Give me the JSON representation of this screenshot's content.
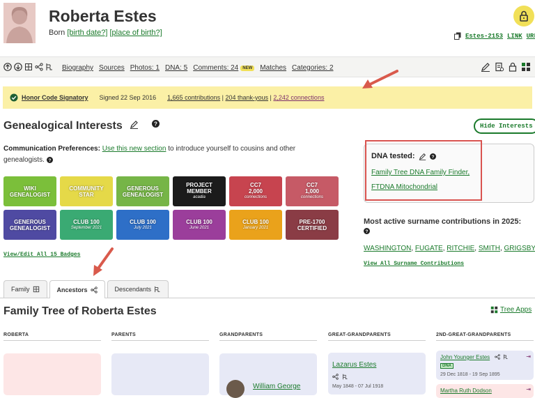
{
  "profile": {
    "name": "Roberta Estes",
    "born_prefix": "Born",
    "birth_date": "[birth date?]",
    "birth_place": "[place of birth?]",
    "id": "Estes-2153",
    "link_label": "LINK",
    "url_label": "URL"
  },
  "nav": {
    "biography": "Biography",
    "sources": "Sources",
    "photos": "Photos: 1",
    "dna": "DNA: 5",
    "comments": "Comments: 24",
    "new_badge": "NEW",
    "matches": "Matches",
    "categories": "Categories: 2"
  },
  "honor": {
    "label": "Honor Code Signatory",
    "signed": "Signed 22 Sep 2016",
    "contributions": "1,665 contributions",
    "sep1": " | ",
    "thankyous": "204 thank-yous",
    "sep2": " | ",
    "connections": "2,242 connections"
  },
  "interests": {
    "title": "Genealogical Interests",
    "hide_button": "Hide Interests",
    "comm_label": "Communication Preferences:",
    "comm_link": "Use this new section",
    "comm_text": " to introduce yourself to cousins and other genealogists."
  },
  "badges": [
    {
      "line1": "WIKI",
      "line2": "GENEALOGIST",
      "sub": "",
      "color": "#7bbf3a"
    },
    {
      "line1": "COMMUNITY",
      "line2": "STAR",
      "sub": "",
      "color": "#e5d948"
    },
    {
      "line1": "GENEROUS",
      "line2": "GENEALOGIST",
      "sub": "",
      "color": "#76b547"
    },
    {
      "line1": "PROJECT",
      "line2": "MEMBER",
      "sub": "acadia",
      "color": "#1b1b1b"
    },
    {
      "line1": "CC7",
      "line2": "2,000",
      "sub": "connections",
      "color": "#c7444f"
    },
    {
      "line1": "CC7",
      "line2": "1,000",
      "sub": "connections",
      "color": "#c65a66"
    },
    {
      "line1": "GENEROUS",
      "line2": "GENEALOGIST",
      "sub": "",
      "color": "#4f4aa2"
    },
    {
      "line1": "CLUB 100",
      "line2": "",
      "sub": "September 2021",
      "color": "#3aaa73"
    },
    {
      "line1": "CLUB 100",
      "line2": "",
      "sub": "July 2021",
      "color": "#2e6fc7"
    },
    {
      "line1": "CLUB 100",
      "line2": "",
      "sub": "June 2021",
      "color": "#9b3e9b"
    },
    {
      "line1": "CLUB 100",
      "line2": "",
      "sub": "January 2021",
      "color": "#eaa21b"
    },
    {
      "line1": "PRE-1700",
      "line2": "CERTIFIED",
      "sub": "",
      "color": "#8a3c45"
    }
  ],
  "view_badges": "View/Edit All 15 Badges",
  "dna": {
    "title": "DNA tested:",
    "link1": "Family Tree DNA Family Finder,",
    "link2": "FTDNA Mitochondrial"
  },
  "surnames": {
    "title": "Most active surname contributions in 2025:",
    "items": [
      "WASHINGTON",
      "FUGATE",
      "RITCHIE",
      "SMITH",
      "GRIGSBY"
    ],
    "view_all": "View All Surname Contributions"
  },
  "tabs": [
    {
      "label": "Family"
    },
    {
      "label": "Ancestors"
    },
    {
      "label": "Descendants"
    }
  ],
  "tree": {
    "title": "Family Tree of Roberta Estes",
    "apps": "Tree Apps",
    "columns": [
      "ROBERTA",
      "PARENTS",
      "GRANDPARENTS",
      "GREAT-GRANDPARENTS",
      "2ND-GREAT-GRANDPARENTS"
    ],
    "grandparent_name": "William George",
    "gg_name": "Lazarus Estes",
    "gg_dates": "May 1848 - 07 Jul 1918",
    "ggg_name": "John Younger Estes",
    "ggg_dna": "DNA",
    "ggg_dates": "29 Dec 1818 - 19 Sep 1895",
    "ggg2_name": "Martha Ruth Dodson"
  }
}
